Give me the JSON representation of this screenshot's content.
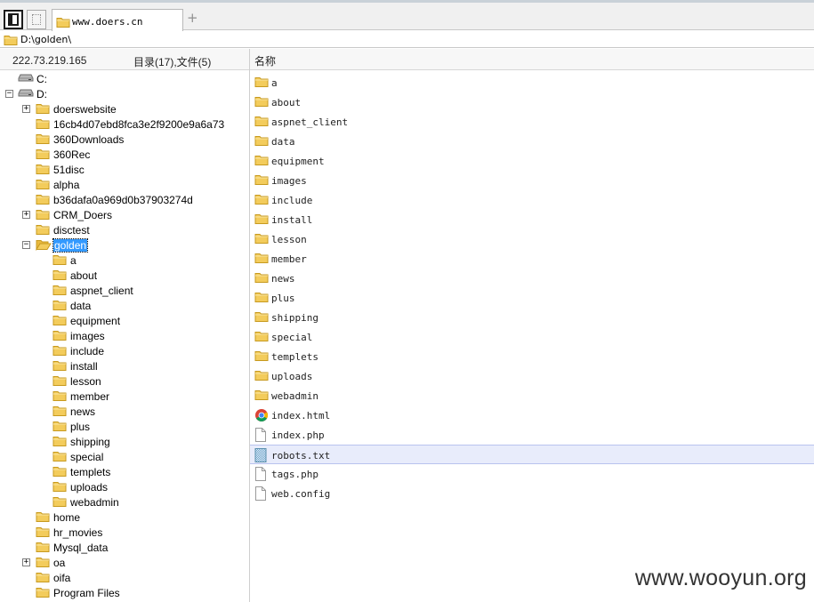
{
  "tab": {
    "label": "www.doers.cn",
    "add": "+"
  },
  "address": {
    "path": "D:\\golden\\"
  },
  "header": {
    "ip": "222.73.219.165",
    "summary": "目录(17),文件(5)",
    "name_col": "名称"
  },
  "tree": [
    {
      "label": "C:",
      "icon": "drive-icon",
      "depth": 0,
      "expander": ""
    },
    {
      "label": "D:",
      "icon": "drive-icon",
      "depth": 0,
      "expander": "−"
    },
    {
      "label": "doerswebsite",
      "icon": "folder-icon",
      "depth": 1,
      "expander": "+"
    },
    {
      "label": "16cb4d07ebd8fca3e2f9200e9a6a73",
      "icon": "folder-icon",
      "depth": 1,
      "expander": ""
    },
    {
      "label": "360Downloads",
      "icon": "folder-icon",
      "depth": 1,
      "expander": ""
    },
    {
      "label": "360Rec",
      "icon": "folder-icon",
      "depth": 1,
      "expander": ""
    },
    {
      "label": "51disc",
      "icon": "folder-icon",
      "depth": 1,
      "expander": ""
    },
    {
      "label": "alpha",
      "icon": "folder-icon",
      "depth": 1,
      "expander": ""
    },
    {
      "label": "b36dafa0a969d0b37903274d",
      "icon": "folder-icon",
      "depth": 1,
      "expander": ""
    },
    {
      "label": "CRM_Doers",
      "icon": "folder-icon",
      "depth": 1,
      "expander": "+"
    },
    {
      "label": "disctest",
      "icon": "folder-icon",
      "depth": 1,
      "expander": ""
    },
    {
      "label": "golden",
      "icon": "folder-open-icon",
      "depth": 1,
      "expander": "−",
      "selected": true
    },
    {
      "label": "a",
      "icon": "folder-icon",
      "depth": 2,
      "expander": ""
    },
    {
      "label": "about",
      "icon": "folder-icon",
      "depth": 2,
      "expander": ""
    },
    {
      "label": "aspnet_client",
      "icon": "folder-icon",
      "depth": 2,
      "expander": ""
    },
    {
      "label": "data",
      "icon": "folder-icon",
      "depth": 2,
      "expander": ""
    },
    {
      "label": "equipment",
      "icon": "folder-icon",
      "depth": 2,
      "expander": ""
    },
    {
      "label": "images",
      "icon": "folder-icon",
      "depth": 2,
      "expander": ""
    },
    {
      "label": "include",
      "icon": "folder-icon",
      "depth": 2,
      "expander": ""
    },
    {
      "label": "install",
      "icon": "folder-icon",
      "depth": 2,
      "expander": ""
    },
    {
      "label": "lesson",
      "icon": "folder-icon",
      "depth": 2,
      "expander": ""
    },
    {
      "label": "member",
      "icon": "folder-icon",
      "depth": 2,
      "expander": ""
    },
    {
      "label": "news",
      "icon": "folder-icon",
      "depth": 2,
      "expander": ""
    },
    {
      "label": "plus",
      "icon": "folder-icon",
      "depth": 2,
      "expander": ""
    },
    {
      "label": "shipping",
      "icon": "folder-icon",
      "depth": 2,
      "expander": ""
    },
    {
      "label": "special",
      "icon": "folder-icon",
      "depth": 2,
      "expander": ""
    },
    {
      "label": "templets",
      "icon": "folder-icon",
      "depth": 2,
      "expander": ""
    },
    {
      "label": "uploads",
      "icon": "folder-icon",
      "depth": 2,
      "expander": ""
    },
    {
      "label": "webadmin",
      "icon": "folder-icon",
      "depth": 2,
      "expander": ""
    },
    {
      "label": "home",
      "icon": "folder-icon",
      "depth": 1,
      "expander": ""
    },
    {
      "label": "hr_movies",
      "icon": "folder-icon",
      "depth": 1,
      "expander": ""
    },
    {
      "label": "Mysql_data",
      "icon": "folder-icon",
      "depth": 1,
      "expander": ""
    },
    {
      "label": "oa",
      "icon": "folder-icon",
      "depth": 1,
      "expander": "+"
    },
    {
      "label": "oifa",
      "icon": "folder-icon",
      "depth": 1,
      "expander": ""
    },
    {
      "label": "Program Files",
      "icon": "folder-icon",
      "depth": 1,
      "expander": ""
    },
    {
      "label": "",
      "icon": "folder-icon",
      "depth": 1,
      "expander": ""
    }
  ],
  "files": [
    {
      "label": "a",
      "icon": "folder-icon"
    },
    {
      "label": "about",
      "icon": "folder-icon"
    },
    {
      "label": "aspnet_client",
      "icon": "folder-icon"
    },
    {
      "label": "data",
      "icon": "folder-icon"
    },
    {
      "label": "equipment",
      "icon": "folder-icon"
    },
    {
      "label": "images",
      "icon": "folder-icon"
    },
    {
      "label": "include",
      "icon": "folder-icon"
    },
    {
      "label": "install",
      "icon": "folder-icon"
    },
    {
      "label": "lesson",
      "icon": "folder-icon"
    },
    {
      "label": "member",
      "icon": "folder-icon"
    },
    {
      "label": "news",
      "icon": "folder-icon"
    },
    {
      "label": "plus",
      "icon": "folder-icon"
    },
    {
      "label": "shipping",
      "icon": "folder-icon"
    },
    {
      "label": "special",
      "icon": "folder-icon"
    },
    {
      "label": "templets",
      "icon": "folder-icon"
    },
    {
      "label": "uploads",
      "icon": "folder-icon"
    },
    {
      "label": "webadmin",
      "icon": "folder-icon"
    },
    {
      "label": "index.html",
      "icon": "chrome-icon"
    },
    {
      "label": "index.php",
      "icon": "file-icon"
    },
    {
      "label": "robots.txt",
      "icon": "text-file-icon",
      "selected": true
    },
    {
      "label": "tags.php",
      "icon": "file-icon"
    },
    {
      "label": "web.config",
      "icon": "file-icon"
    }
  ],
  "watermark": "www.wooyun.org",
  "colors": {
    "folder": "#f3cc5c",
    "folder_edge": "#c79a1f",
    "selection": "#3399ff",
    "row_highlight": "#e8ecfb"
  }
}
